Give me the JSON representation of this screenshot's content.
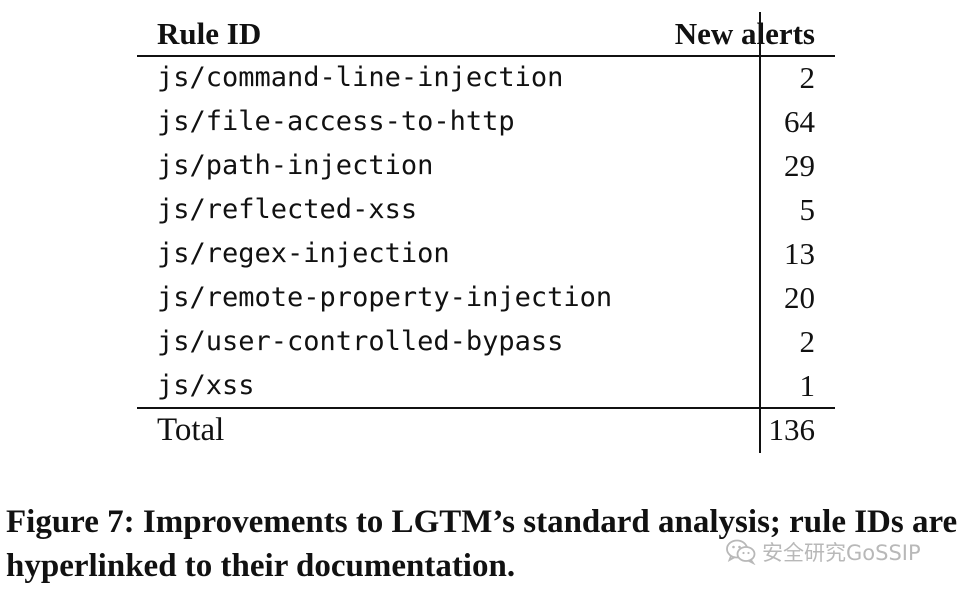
{
  "table": {
    "headers": {
      "rule_id": "Rule ID",
      "new_alerts": "New alerts"
    },
    "rows": [
      {
        "rule_id": "js/command-line-injection",
        "new_alerts": "2"
      },
      {
        "rule_id": "js/file-access-to-http",
        "new_alerts": "64"
      },
      {
        "rule_id": "js/path-injection",
        "new_alerts": "29"
      },
      {
        "rule_id": "js/reflected-xss",
        "new_alerts": "5"
      },
      {
        "rule_id": "js/regex-injection",
        "new_alerts": "13"
      },
      {
        "rule_id": "js/remote-property-injection",
        "new_alerts": "20"
      },
      {
        "rule_id": "js/user-controlled-bypass",
        "new_alerts": "2"
      },
      {
        "rule_id": "js/xss",
        "new_alerts": "1"
      }
    ],
    "total": {
      "label": "Total",
      "value": "136"
    }
  },
  "caption": {
    "text": "Figure 7: Improvements to LGTM’s standard analysis; rule IDs are hyperlinked to their documentation."
  },
  "watermark": {
    "text": "安全研究GoSSIP",
    "icon": "wechat-icon"
  }
}
